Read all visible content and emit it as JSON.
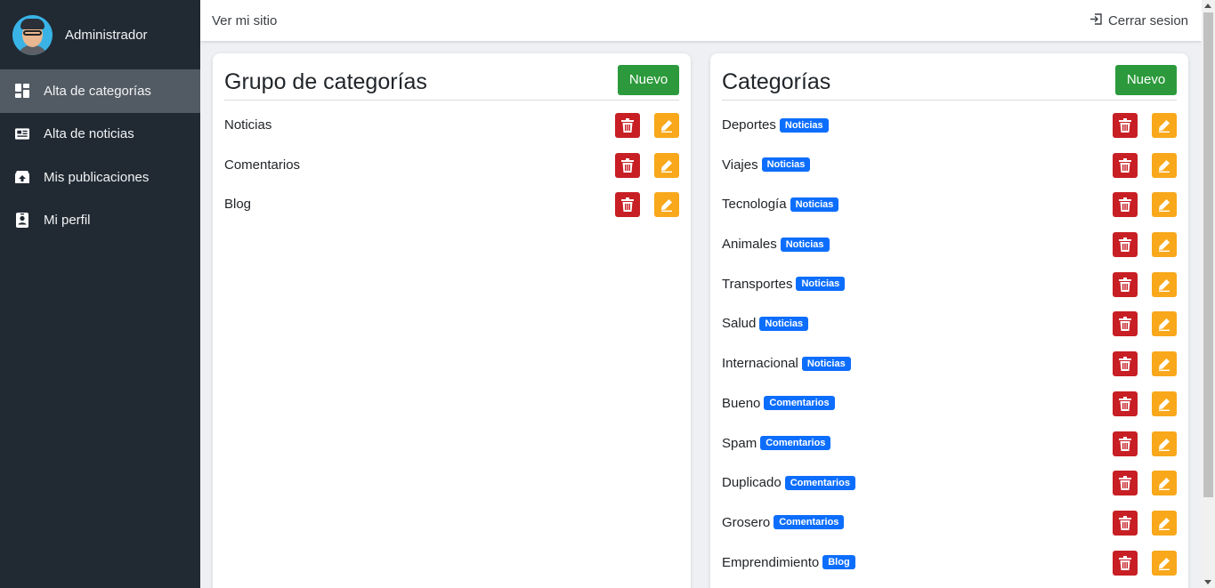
{
  "sidebar": {
    "user_name": "Administrador",
    "items": [
      {
        "label": "Alta de categorías",
        "icon": "dashboard-grid-icon",
        "active": true
      },
      {
        "label": "Alta de noticias",
        "icon": "newspaper-icon",
        "active": false
      },
      {
        "label": "Mis publicaciones",
        "icon": "archive-upload-icon",
        "active": false
      },
      {
        "label": "Mi perfil",
        "icon": "profile-card-icon",
        "active": false
      }
    ]
  },
  "topbar": {
    "site_link": "Ver mi sitio",
    "logout_label": "Cerrar sesion"
  },
  "groups_card": {
    "title": "Grupo de categorías",
    "new_label": "Nuevo",
    "items": [
      "Noticias",
      "Comentarios",
      "Blog"
    ]
  },
  "categories_card": {
    "title": "Categorías",
    "new_label": "Nuevo",
    "items": [
      {
        "name": "Deportes",
        "group": "Noticias"
      },
      {
        "name": "Viajes",
        "group": "Noticias"
      },
      {
        "name": "Tecnología",
        "group": "Noticias"
      },
      {
        "name": "Animales",
        "group": "Noticias"
      },
      {
        "name": "Transportes",
        "group": "Noticias"
      },
      {
        "name": "Salud",
        "group": "Noticias"
      },
      {
        "name": "Internacional",
        "group": "Noticias"
      },
      {
        "name": "Bueno",
        "group": "Comentarios"
      },
      {
        "name": "Spam",
        "group": "Comentarios"
      },
      {
        "name": "Duplicado",
        "group": "Comentarios"
      },
      {
        "name": "Grosero",
        "group": "Comentarios"
      },
      {
        "name": "Emprendimiento",
        "group": "Blog"
      }
    ]
  },
  "colors": {
    "sidebar_bg": "#212a33",
    "active_item_bg": "#525a63",
    "new_button": "#2c9a3c",
    "delete_button": "#c71f24",
    "edit_button": "#f8a81a",
    "badge": "#0d6efd"
  }
}
